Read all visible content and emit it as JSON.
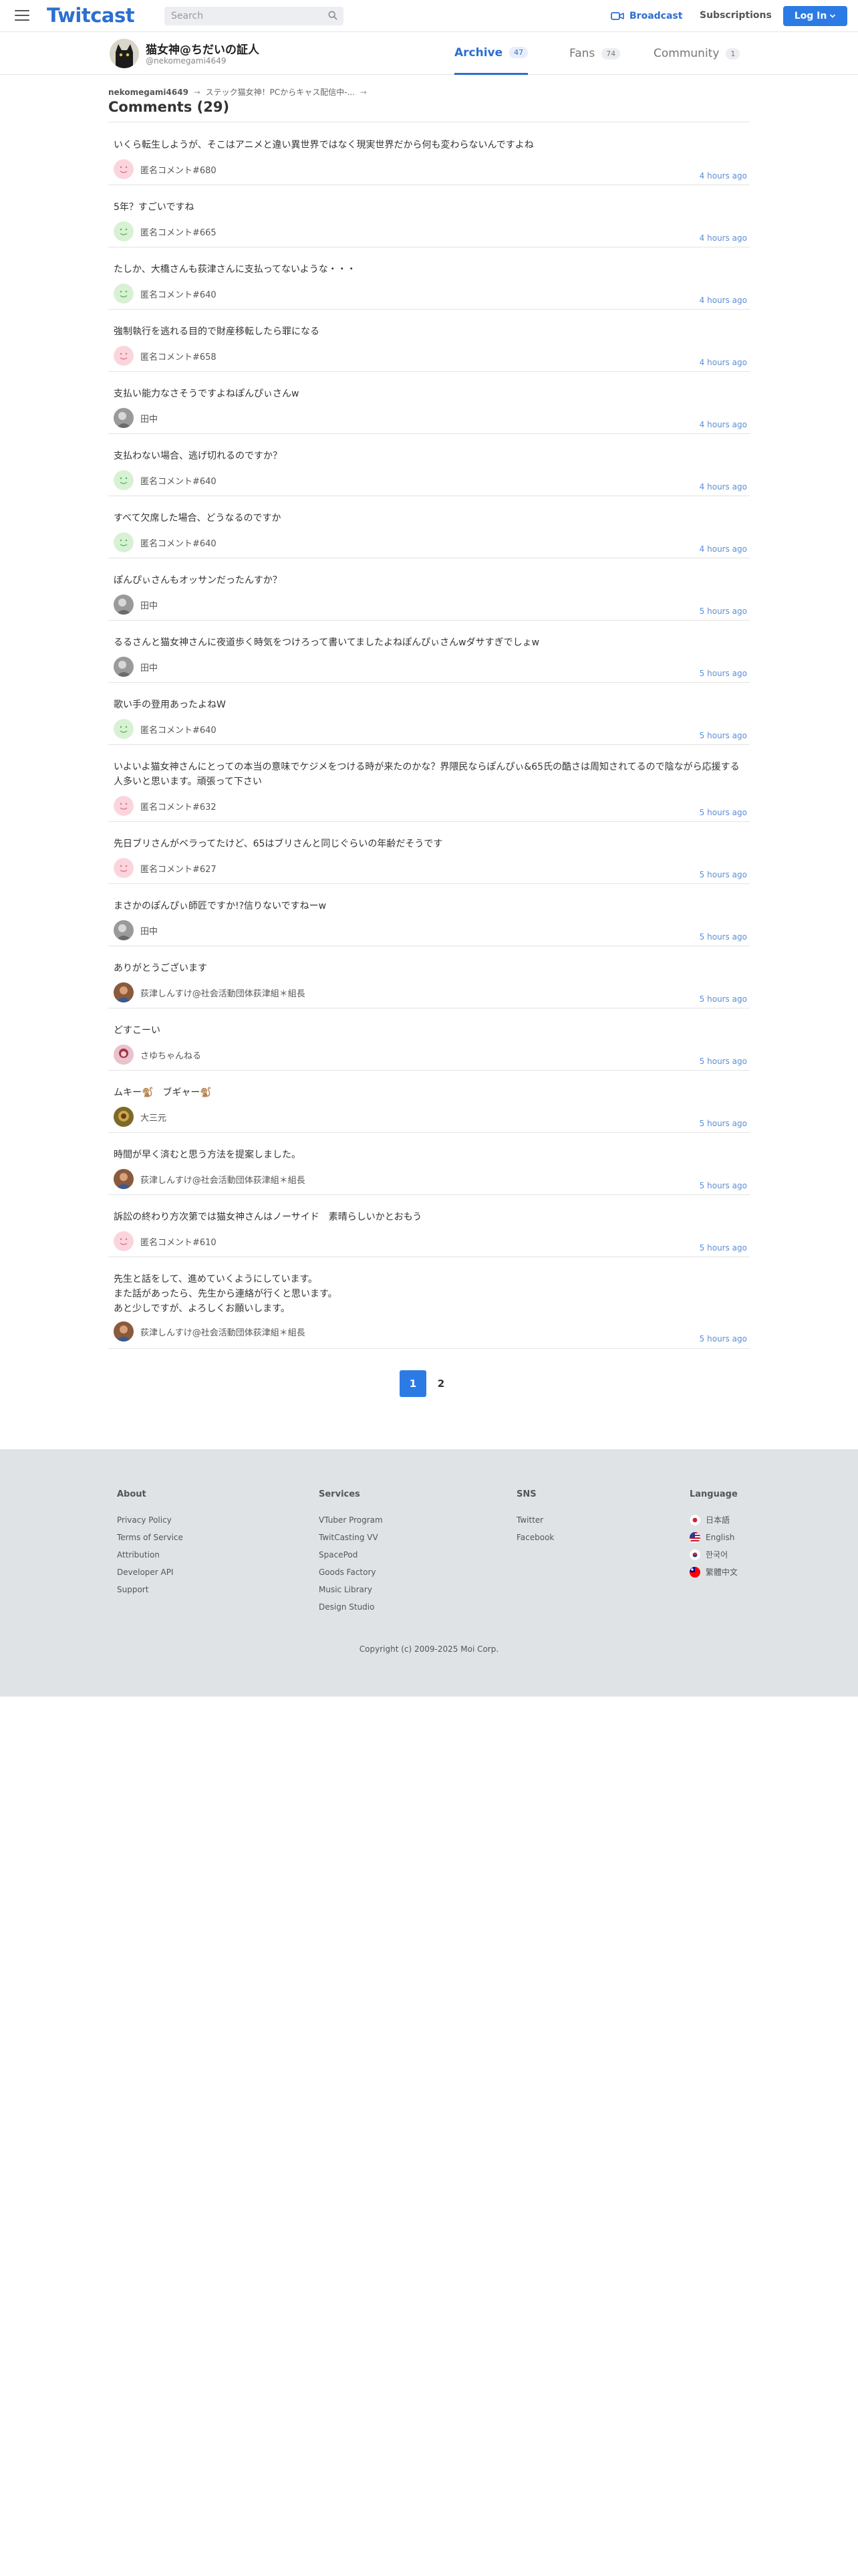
{
  "header": {
    "logo": "Twitcast",
    "search_placeholder": "Search",
    "broadcast_label": "Broadcast",
    "subscriptions_label": "Subscriptions",
    "login_label": "Log In",
    "accent_color": "#2c7be5"
  },
  "profile": {
    "name": "猫女神@ちだいの証人",
    "handle": "@nekomegami4649",
    "tabs": [
      {
        "label": "Archive",
        "count": "47"
      },
      {
        "label": "Fans",
        "count": "74"
      },
      {
        "label": "Community",
        "count": "1"
      }
    ]
  },
  "breadcrumb": {
    "user": "nekomegami4649",
    "movie": "ステック猫女神！PCからキャス配信中-...",
    "arrow": "→"
  },
  "title": "Comments (29)",
  "comments": [
    {
      "text": "いくら転生しようが、そこはアニメと違い異世界ではなく現実世界だから何も変わらないんですよね",
      "user": "匿名コメント#680",
      "avatar": "pink-face",
      "time": "4 hours ago"
    },
    {
      "text": "5年？すごいですね",
      "user": "匿名コメント#665",
      "avatar": "green-face",
      "time": "4 hours ago"
    },
    {
      "text": "たしか、大橋さんも荻津さんに支払ってないような・・・",
      "user": "匿名コメント#640",
      "avatar": "green-face",
      "time": "4 hours ago"
    },
    {
      "text": "強制執行を逃れる目的で財産移転したら罪になる",
      "user": "匿名コメント#658",
      "avatar": "pink-face",
      "time": "4 hours ago"
    },
    {
      "text": "支払い能力なさそうですよねぽんぴぃさんw",
      "user": "田中",
      "avatar": "gray-photo",
      "time": "4 hours ago"
    },
    {
      "text": "支払わない場合、逃げ切れるのですか？",
      "user": "匿名コメント#640",
      "avatar": "green-face",
      "time": "4 hours ago"
    },
    {
      "text": "すべて欠席した場合、どうなるのですか",
      "user": "匿名コメント#640",
      "avatar": "green-face",
      "time": "4 hours ago"
    },
    {
      "text": "ぽんぴぃさんもオッサンだったんすか？",
      "user": "田中",
      "avatar": "gray-photo",
      "time": "5 hours ago"
    },
    {
      "text": "るるさんと猫女神さんに夜道歩く時気をつけろって書いてましたよねぽんぴぃさんwダサすぎでしょw",
      "user": "田中",
      "avatar": "gray-photo",
      "time": "5 hours ago"
    },
    {
      "text": "歌い手の登用あったよねW",
      "user": "匿名コメント#640",
      "avatar": "green-face",
      "time": "5 hours ago"
    },
    {
      "text": "いよいよ猫女神さんにとっての本当の意味でケジメをつける時が来たのかな？界隈民ならぽんぴぃ&65氏の酷さは周知されてるので陰ながら応援する人多いと思います。頑張って下さい",
      "user": "匿名コメント#632",
      "avatar": "pink-face",
      "time": "5 hours ago"
    },
    {
      "text": "先日ブリさんがベラってたけど、65はブリさんと同じぐらいの年齢だそうです",
      "user": "匿名コメント#627",
      "avatar": "pink-face",
      "time": "5 hours ago"
    },
    {
      "text": "まさかのぽんぴぃ師匠ですか!?信りないですねーw",
      "user": "田中",
      "avatar": "gray-photo",
      "time": "5 hours ago"
    },
    {
      "text": "ありがとうございます",
      "user": "荻津しんすけ@社会活動団体荻津組＊組長",
      "avatar": "brown-photo",
      "time": "5 hours ago"
    },
    {
      "text": "どすこーい",
      "user": "さゆちゃんねる",
      "avatar": "pink-photo",
      "time": "5 hours ago"
    },
    {
      "text": "ムキー🐒　ブギャー🐒",
      "user": "大三元",
      "avatar": "olive-photo",
      "time": "5 hours ago"
    },
    {
      "text": "時間が早く済むと思う方法を提案しました。",
      "user": "荻津しんすけ@社会活動団体荻津組＊組長",
      "avatar": "brown-photo",
      "time": "5 hours ago"
    },
    {
      "text": "訴訟の終わり方次第では猫女神さんはノーサイド　素晴らしいかとおもう",
      "user": "匿名コメント#610",
      "avatar": "pink-face",
      "time": "5 hours ago"
    },
    {
      "text": "先生と話をして、進めていくようにしています。\nまた話があったら、先生から連絡が行くと思います。\nあと少しですが、よろしくお願いします。",
      "user": "荻津しんすけ@社会活動団体荻津組＊組長",
      "avatar": "brown-photo",
      "time": "5 hours ago"
    }
  ],
  "pagination": {
    "pages": [
      "1",
      "2"
    ],
    "current": "1"
  },
  "footer": {
    "about": {
      "heading": "About",
      "links": [
        "Privacy Policy",
        "Terms of Service",
        "Attribution",
        "Developer API",
        "Support"
      ]
    },
    "services": {
      "heading": "Services",
      "links": [
        "VTuber Program",
        "TwitCasting VV",
        "SpacePod",
        "Goods Factory",
        "Music Library",
        "Design Studio"
      ]
    },
    "sns": {
      "heading": "SNS",
      "links": [
        "Twitter",
        "Facebook"
      ]
    },
    "language": {
      "heading": "Language",
      "links": [
        "日本語",
        "English",
        "한국어",
        "繁體中文"
      ],
      "flags": [
        "flag-japan-icon",
        "flag-us-icon",
        "flag-korea-icon",
        "flag-taiwan-icon"
      ]
    },
    "copyright": "Copyright (c) 2009-2025 Moi Corp."
  }
}
